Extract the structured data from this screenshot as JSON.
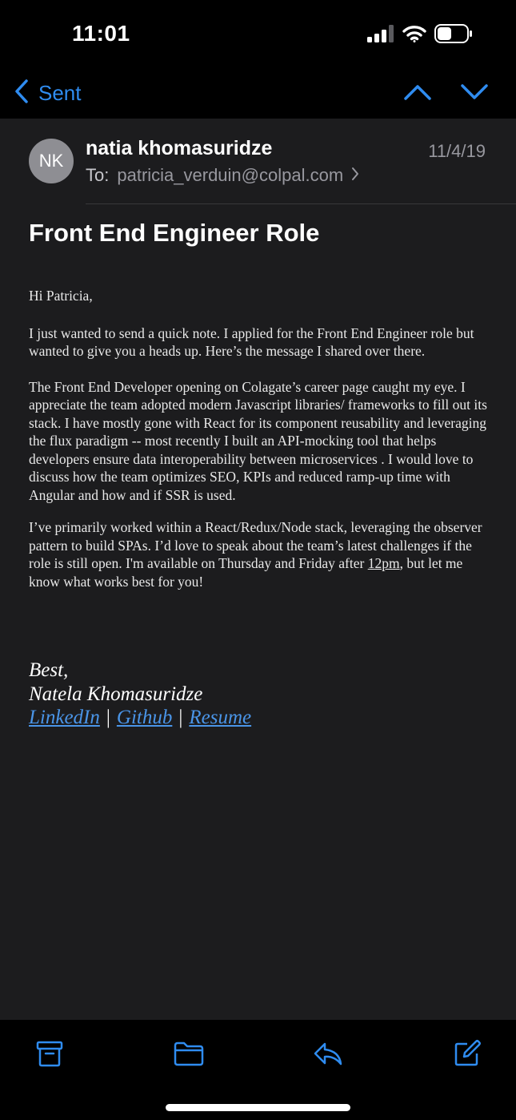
{
  "status_bar": {
    "time": "11:01"
  },
  "nav": {
    "back_label": "Sent"
  },
  "message": {
    "avatar_initials": "NK",
    "sender": "natia khomasuridze",
    "date": "11/4/19",
    "to_prefix": "To:",
    "to_address": "patricia_verduin@colpal.com",
    "subject": "Front End Engineer Role",
    "greeting": "Hi Patricia,",
    "para1": "I just wanted to send a quick note. I applied for the Front End Engineer role but wanted to give you a heads up. Here’s the message I shared over there.",
    "para2": "The Front End Developer opening on Colagate’s career page caught my eye. I appreciate the team adopted modern Javascript libraries/ frameworks to fill out its stack. I have mostly gone with React for its component reusability and leveraging the flux paradigm -- most recently I built an API-mocking tool that helps developers ensure data interoperability between microservices . I would love to discuss how the team optimizes SEO, KPIs and reduced ramp-up time with Angular and how and if SSR is used.",
    "para3_start": "I’ve primarily worked within a React/Redux/Node stack, leveraging the observer pattern to build SPAs. I’d love to speak about the team’s latest challenges if the role is still open. I'm available on Thursday and Friday after ",
    "para3_time": "12pm",
    "para3_end": ", but let me know what works best for you!",
    "signoff": "Best,",
    "signature_name": "Natela Khomasuridze",
    "links": {
      "linkedin": "LinkedIn",
      "github": "Github",
      "resume": "Resume",
      "separator": "|"
    }
  },
  "colors": {
    "accent": "#2f8cf0",
    "background": "#1c1c1e",
    "bars": "#000000",
    "link": "#4a95e8"
  }
}
